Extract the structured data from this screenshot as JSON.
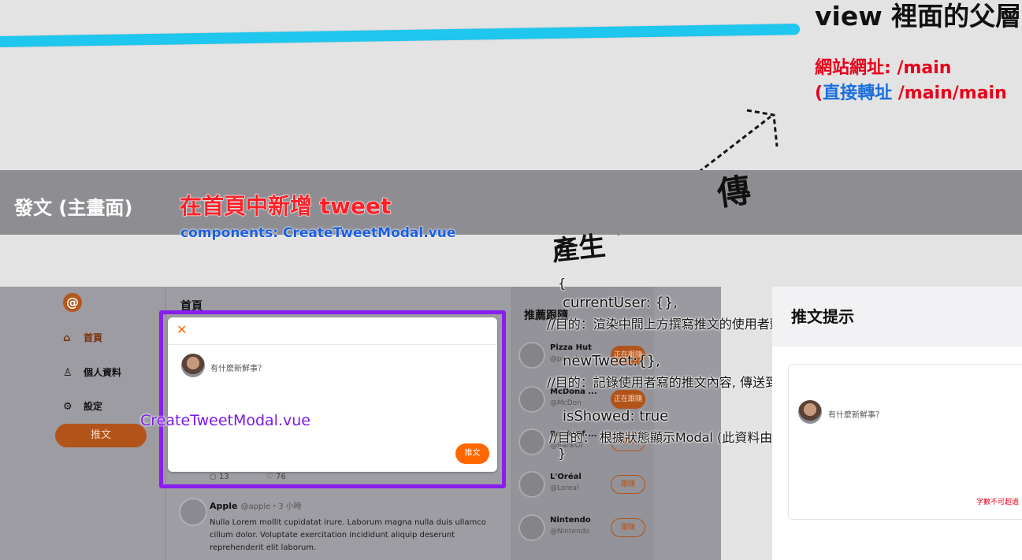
{
  "top": {
    "view_title": "view 裡面的父層",
    "url_label": "網站網址: /main",
    "redirect_open": "(",
    "redirect_label": "直接轉址",
    "redirect_path": " /main/main"
  },
  "band": {
    "title": "發文 (主畫面)",
    "headline": "在首頁中新增 tweet",
    "component": "components: CreateTweetModal.vue"
  },
  "handwriting": {
    "pass": "傳",
    "produce": "產生"
  },
  "app": {
    "logo": "@",
    "nav": [
      {
        "icon": "home-icon",
        "label": "首頁"
      },
      {
        "icon": "user-icon",
        "label": "個人資料"
      },
      {
        "icon": "gear-icon",
        "label": "設定"
      }
    ],
    "tweet_button": "推文",
    "main_title": "首頁",
    "stats": {
      "replies": "13",
      "likes": "76"
    },
    "tweet": {
      "name": "Apple",
      "meta": "@apple・3 小時",
      "body": "Nulla Lorem mollit cupidatat irure. Laborum magna nulla duis ullamco cillum dolor. Voluptate exercitation incididunt aliquip deserunt reprehenderit elit laborum."
    },
    "recommend_title": "推薦跟隨",
    "recommend": [
      {
        "name": "Pizza Hut",
        "handle": "@pizzahut",
        "button": "正在跟隨",
        "following": true
      },
      {
        "name": "McDona ...",
        "handle": "@McDon",
        "button": "正在跟隨",
        "following": true
      },
      {
        "name": "Bank Of ...",
        "handle": "@BankOf",
        "button": "跟隨",
        "following": false
      },
      {
        "name": "L'Oréal",
        "handle": "@Loreal",
        "button": "跟隨",
        "following": false
      },
      {
        "name": "Nintendo",
        "handle": "@Nintendo",
        "button": "跟隨",
        "following": false
      }
    ]
  },
  "modal": {
    "close": "✕",
    "placeholder": "有什麼新鮮事？",
    "submit": "推文",
    "label": "CreateTweetModal.vue"
  },
  "data_notes": {
    "brace_open": "{",
    "current_user": "currentUser: {},",
    "purpose_1": "//目的：渲染中間上方撰寫推文的使用者頭像",
    "new_tweet": "newTweet:{},",
    "purpose_2": "//目的：記錄使用者寫的推文內容, 傳送到後端",
    "is_showed": "isShowed: true",
    "purpose_3": "//目的： 根據狀態顯示Modal (此資料由前端產生)",
    "brace_close": "}"
  },
  "preview": {
    "title": "推文提示",
    "placeholder": "有什麼新鮮事？",
    "warning": "字數不可超過"
  },
  "colors": {
    "accent": "#ff6600",
    "modal_border": "#8a1df0",
    "cyan_line": "#1fc6ee",
    "red_text": "#e8001c",
    "blue_text": "#1a6ee0"
  }
}
